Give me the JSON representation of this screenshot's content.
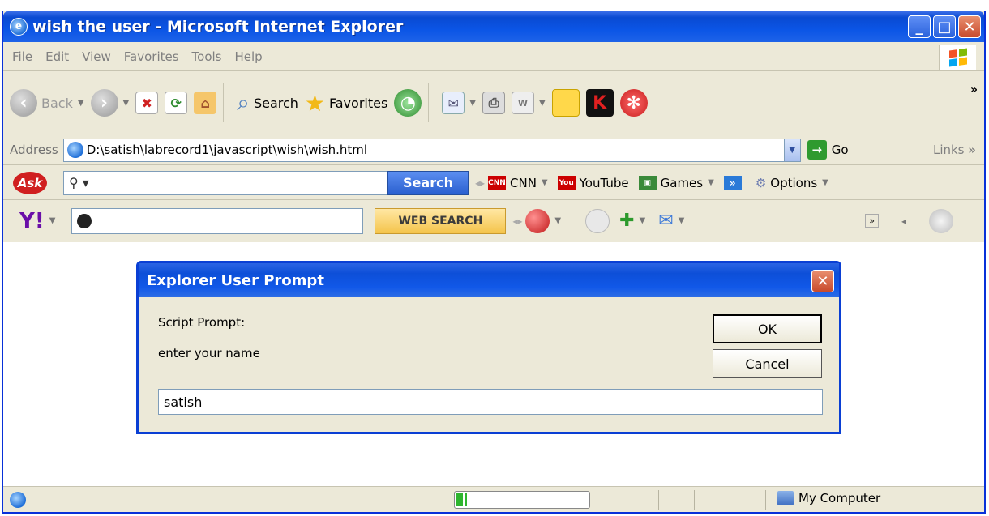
{
  "window": {
    "title": "wish the user - Microsoft Internet Explorer",
    "minimize": "_",
    "maximize": "□",
    "close": "✕"
  },
  "menu": [
    "File",
    "Edit",
    "View",
    "Favorites",
    "Tools",
    "Help"
  ],
  "toolbar": {
    "back_label": "Back",
    "search_label": "Search",
    "favorites_label": "Favorites",
    "overflow": "»"
  },
  "address": {
    "label": "Address",
    "value": "D:\\satish\\labrecord1\\javascript\\wish\\wish.html",
    "go_label": "Go",
    "links_label": "Links",
    "links_overflow": "»"
  },
  "ask_toolbar": {
    "logo": "Ask",
    "search_button": "Search",
    "cnn": "CNN",
    "youtube": "YouTube",
    "games": "Games",
    "overflow": "»",
    "options": "Options"
  },
  "yahoo_toolbar": {
    "logo": "Y!",
    "web_search": "WEB SEARCH"
  },
  "dialog": {
    "title": "Explorer User Prompt",
    "script_prompt_label": "Script Prompt:",
    "message": "enter your name",
    "ok_label": "OK",
    "cancel_label": "Cancel",
    "input_value": "satish"
  },
  "status": {
    "zone": "My Computer",
    "progress": 0.08
  },
  "colors": {
    "titlebar": "#0a4ad2",
    "chrome": "#ece9d8",
    "close_button": "#c84a2d"
  },
  "icons": [
    "ie-icon",
    "back-icon",
    "forward-icon",
    "stop-icon",
    "refresh-icon",
    "home-icon",
    "search-icon",
    "favorites-star-icon",
    "history-icon",
    "mail-icon",
    "print-icon",
    "edit-icon",
    "notes-icon",
    "kaspersky-icon",
    "options-icon",
    "go-arrow-icon",
    "computer-icon",
    "windows-flag-icon"
  ]
}
